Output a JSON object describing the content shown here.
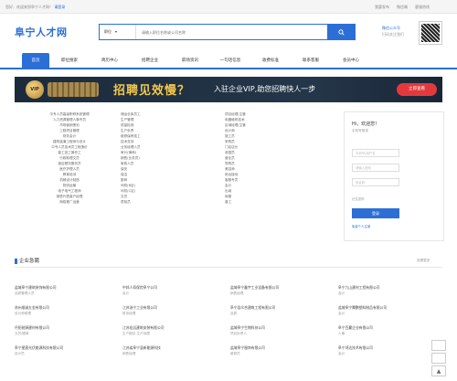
{
  "topbar": {
    "welcome": "您好，欢迎来到阜宁人才网！",
    "links": [
      "请登录"
    ],
    "right": [
      "我要发布",
      "微信端",
      "客服热线"
    ]
  },
  "header": {
    "logo": "阜宁人才网",
    "search_type": "职位",
    "search_placeholder": "请输入职位名称或公司名称",
    "links": [
      "微信公众号",
      "扫码关注我们"
    ]
  },
  "nav": {
    "items": [
      "首页",
      "职位搜索",
      "简历中心",
      "招聘企业",
      "职场资讯",
      "一句话信息",
      "收费标准",
      "联系客服",
      "会员中心"
    ],
    "active_index": 0
  },
  "banner": {
    "badge": "VIP",
    "headline": "招聘见效慢？",
    "sub": "入驻企业VIP,助您招聘快人一步",
    "cta": "立即查看"
  },
  "categories": {
    "col1": [
      "中专人员高级职称系统管理",
      "人力资源管理人事专员",
      "市场营销策划",
      "工程项目管理",
      "财务会计",
      "建筑装潢工程师与设计",
      "中专人员技术员工程造价",
      "普工技工操作工",
      "行政助理文员",
      "酒店餐饮服务员",
      "医疗护理人员",
      "教育培训",
      "机械设计制造",
      "物流运输",
      "电子电气工程师",
      "销售代表客户经理",
      "网络推广运营"
    ],
    "col2": [
      "储运仓库员工",
      "生产管理",
      "质量检测",
      "生产负责",
      "维修保养技工",
      "技术支持",
      "业务经理人员",
      "审计(律师)",
      "销售(业务员)",
      "家政人员",
      "保安",
      "保洁",
      "厨师",
      "司机(B证)",
      "司机(C证)",
      "文员",
      "质检员"
    ],
    "col3": [
      "项目经理/主管",
      "电器维修技术",
      "区域经理/主管",
      "设计师",
      "施工员",
      "采购员",
      "门店店长",
      "收银员",
      "营业员",
      "导购员",
      "美容师",
      "前台接待",
      "客服专员",
      "会计",
      "出纳",
      "库管",
      "普工"
    ]
  },
  "login": {
    "greeting": "Hi，欢迎您！",
    "sub": "手机号登录",
    "user_placeholder": "手机号/用户名",
    "pass_placeholder": "请输入密码",
    "code_placeholder": "验证码",
    "remember": "记住密码",
    "button": "登录",
    "register": "免费个人注册"
  },
  "section": {
    "title": "企业急聘",
    "more": "查看更多"
  },
  "jobs": [
    {
      "co": "盐城阜宁建筑装饰有限公司",
      "pos": "品质管理人员"
    },
    {
      "co": "中邦人寿保险阜宁公司",
      "pos": "会计"
    },
    {
      "co": "盐城阜宁鑫宇工业设备有限公司",
      "pos": "销售经理"
    },
    {
      "co": "阜宁九山建材工程有限公司",
      "pos": "会计"
    },
    {
      "co": "苏州顺诚五金有限公司",
      "pos": "设计师助理"
    },
    {
      "co": "江苏浙宁工业有限公司",
      "pos": "财务经理"
    },
    {
      "co": "阜宁县众合建筑工程有限公司",
      "pos": "品质"
    },
    {
      "co": "盐城阜宁腾鹏塑料制品有限公司",
      "pos": "会计"
    },
    {
      "co": "丹阳驰源建材有限公司",
      "pos": "文员/跟单"
    },
    {
      "co": "江苏宏远建筑安装有限公司",
      "pos": "生产副总 生产经理"
    },
    {
      "co": "盐城阜宁生物科技公司",
      "pos": "项目负责人"
    },
    {
      "co": "阜宁百赢企业有限公司",
      "pos": "人事"
    },
    {
      "co": "阜宁星宸光伏能源科技有限公司",
      "pos": "设计员"
    },
    {
      "co": "江苏省阜宁县新能源科技",
      "pos": "销售经理"
    },
    {
      "co": "盐城阜宁服饰有限公司",
      "pos": "维修员"
    },
    {
      "co": "阜宁鸿达技术有限公司",
      "pos": "会计"
    }
  ],
  "colors": {
    "brand": "#2b6fd6",
    "cta": "#e4393c",
    "banner_bg": "#1c2b3c",
    "headline": "#f5c84c"
  }
}
